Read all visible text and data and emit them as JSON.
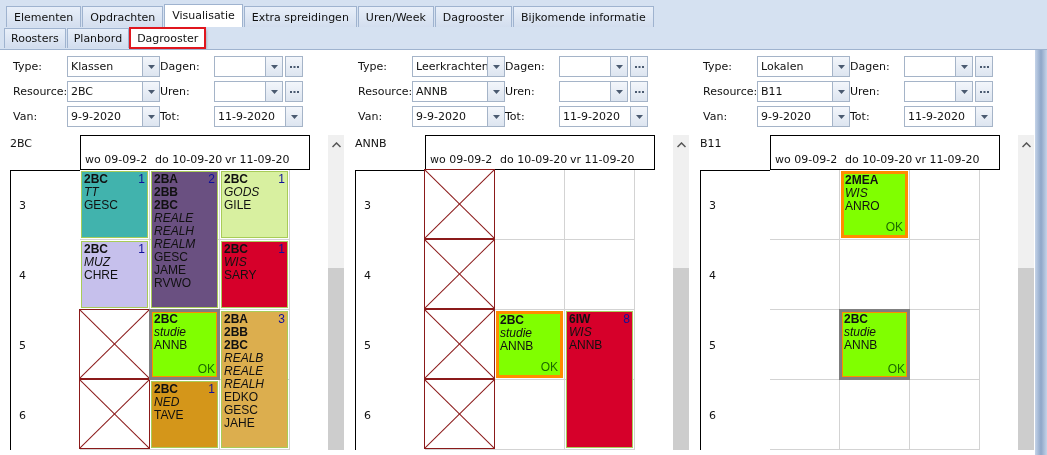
{
  "tabs": [
    {
      "label": "Elementen",
      "selected": false
    },
    {
      "label": "Opdrachten",
      "selected": false
    },
    {
      "label": "Visualisatie",
      "selected": true
    },
    {
      "label": "Extra spreidingen",
      "selected": false
    },
    {
      "label": "Uren/Week",
      "selected": false
    },
    {
      "label": "Dagrooster",
      "selected": false
    },
    {
      "label": "Bijkomende informatie",
      "selected": false
    }
  ],
  "subtabs": [
    {
      "label": "Roosters",
      "selected": false,
      "highlighted": false
    },
    {
      "label": "Planbord",
      "selected": false,
      "highlighted": false
    },
    {
      "label": "Dagrooster",
      "selected": true,
      "highlighted": true
    }
  ],
  "panels": [
    {
      "form": [
        {
          "label": "Type:",
          "kind": "combo",
          "value": "Klassen"
        },
        {
          "label": "Dagen:",
          "kind": "picker"
        },
        {
          "label": "Resource:",
          "kind": "combo",
          "value": "2BC"
        },
        {
          "label": "Uren:",
          "kind": "picker"
        },
        {
          "label": "Van:",
          "kind": "date",
          "value": "9-9-2020"
        },
        {
          "label": "Tot:",
          "kind": "date",
          "value": "11-9-2020"
        }
      ],
      "title": "2BC",
      "periods": [
        "3",
        "4",
        "5",
        "6"
      ],
      "days": [
        {
          "label": "wo 09-09-2",
          "cells": [
            {
              "kind": "lesson",
              "color": "#41b3ad",
              "groups": [
                "2BC"
              ],
              "subjects": [
                "TT"
              ],
              "teachers": [
                "GESC"
              ],
              "count": "1",
              "selected": false,
              "highlighted": false
            },
            {
              "kind": "lesson",
              "color": "#c6c0ec",
              "groups": [
                "2BC"
              ],
              "subjects": [
                "MUZ"
              ],
              "teachers": [
                "CHRE"
              ],
              "count": "1",
              "selected": false,
              "highlighted": false
            },
            {
              "kind": "blocked"
            },
            {
              "kind": "blocked"
            }
          ]
        },
        {
          "label": "do 10-09-20",
          "cells": [
            {
              "kind": "lesson",
              "color": "#6a5081",
              "groups": [
                "2BA",
                "2BB",
                "2BC"
              ],
              "subjects": [
                "REALE",
                "REALH",
                "REALM"
              ],
              "teachers": [
                "GESC",
                "JAME",
                "RVWO"
              ],
              "count": "2",
              "selected": false,
              "highlighted": false
            },
            {
              "kind": "continued"
            },
            {
              "kind": "lesson",
              "color": "#80ff00",
              "groups": [
                "2BC"
              ],
              "subjects": [
                "studie"
              ],
              "teachers": [
                "ANNB"
              ],
              "status": "OK",
              "selected": true,
              "highlighted": true
            },
            {
              "kind": "lesson",
              "color": "#d4961a",
              "groups": [
                "2BC"
              ],
              "subjects": [
                "NED"
              ],
              "teachers": [
                "TAVE"
              ],
              "count": "1",
              "selected": false,
              "highlighted": false
            }
          ]
        },
        {
          "label": "vr 11-09-20",
          "cells": [
            {
              "kind": "lesson",
              "color": "#d8f0a0",
              "groups": [
                "2BC"
              ],
              "subjects": [
                "GODS"
              ],
              "teachers": [
                "GILE"
              ],
              "count": "1",
              "selected": false,
              "highlighted": false
            },
            {
              "kind": "lesson",
              "color": "#d6002a",
              "groups": [
                "2BC"
              ],
              "subjects": [
                "WIS"
              ],
              "teachers": [
                "SARY"
              ],
              "count": "1",
              "selected": false,
              "highlighted": false
            },
            {
              "kind": "lesson",
              "color": "#dcae4e",
              "groups": [
                "2BA",
                "2BB",
                "2BC"
              ],
              "subjects": [
                "REALB",
                "REALE",
                "REALH"
              ],
              "teachers": [
                "EDKO",
                "GESC",
                "JAHE"
              ],
              "count": "3",
              "selected": false,
              "highlighted": false
            },
            {
              "kind": "continued"
            }
          ]
        }
      ]
    },
    {
      "form": [
        {
          "label": "Type:",
          "kind": "combo",
          "value": "Leerkrachten"
        },
        {
          "label": "Dagen:",
          "kind": "picker"
        },
        {
          "label": "Resource:",
          "kind": "combo",
          "value": "ANNB"
        },
        {
          "label": "Uren:",
          "kind": "picker"
        },
        {
          "label": "Van:",
          "kind": "date",
          "value": "9-9-2020"
        },
        {
          "label": "Tot:",
          "kind": "date",
          "value": "11-9-2020"
        }
      ],
      "title": "ANNB",
      "periods": [
        "3",
        "4",
        "5",
        "6"
      ],
      "days": [
        {
          "label": "wo 09-09-2",
          "cells": [
            {
              "kind": "blocked"
            },
            {
              "kind": "blocked"
            },
            {
              "kind": "blocked"
            },
            {
              "kind": "blocked"
            }
          ]
        },
        {
          "label": "do 10-09-20",
          "cells": [
            {
              "kind": "empty"
            },
            {
              "kind": "empty"
            },
            {
              "kind": "lesson",
              "color": "#80ff00",
              "groups": [
                "2BC"
              ],
              "subjects": [
                "studie"
              ],
              "teachers": [
                "ANNB"
              ],
              "status": "OK",
              "selected": false,
              "highlighted": true
            },
            {
              "kind": "empty"
            }
          ]
        },
        {
          "label": "vr 11-09-20",
          "cells": [
            {
              "kind": "empty"
            },
            {
              "kind": "empty"
            },
            {
              "kind": "lesson",
              "color": "#d6002a",
              "groups": [
                "6IW"
              ],
              "subjects": [
                "WIS"
              ],
              "teachers": [
                "ANNB"
              ],
              "count": "8",
              "selected": false,
              "highlighted": false
            },
            {
              "kind": "continued"
            }
          ]
        }
      ]
    },
    {
      "form": [
        {
          "label": "Type:",
          "kind": "combo",
          "value": "Lokalen"
        },
        {
          "label": "Dagen:",
          "kind": "picker"
        },
        {
          "label": "Resource:",
          "kind": "combo",
          "value": "B11"
        },
        {
          "label": "Uren:",
          "kind": "picker"
        },
        {
          "label": "Van:",
          "kind": "date",
          "value": "9-9-2020"
        },
        {
          "label": "Tot:",
          "kind": "date",
          "value": "11-9-2020"
        }
      ],
      "title": "B11",
      "periods": [
        "3",
        "4",
        "5",
        "6"
      ],
      "days": [
        {
          "label": "wo 09-09-2",
          "cells": [
            {
              "kind": "empty"
            },
            {
              "kind": "empty"
            },
            {
              "kind": "empty"
            },
            {
              "kind": "empty"
            }
          ]
        },
        {
          "label": "do 10-09-20",
          "cells": [
            {
              "kind": "lesson",
              "color": "#80ff00",
              "groups": [
                "2MEA"
              ],
              "subjects": [
                "WIS"
              ],
              "teachers": [
                "ANRO"
              ],
              "status": "OK",
              "selected": false,
              "highlighted": true
            },
            {
              "kind": "empty"
            },
            {
              "kind": "lesson",
              "color": "#80ff00",
              "groups": [
                "2BC"
              ],
              "subjects": [
                "studie"
              ],
              "teachers": [
                "ANNB"
              ],
              "status": "OK",
              "selected": true,
              "highlighted": true
            },
            {
              "kind": "empty"
            }
          ]
        },
        {
          "label": "vr 11-09-20",
          "cells": [
            {
              "kind": "empty"
            },
            {
              "kind": "empty"
            },
            {
              "kind": "empty"
            },
            {
              "kind": "empty"
            }
          ]
        }
      ]
    }
  ]
}
